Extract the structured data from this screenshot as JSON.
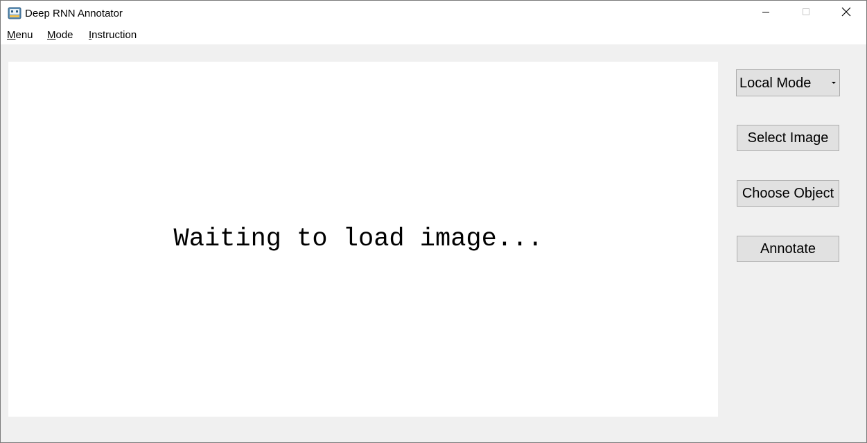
{
  "window": {
    "title": "Deep RNN Annotator"
  },
  "menubar": {
    "items": [
      {
        "accel": "M",
        "rest": "enu"
      },
      {
        "accel": "M",
        "rest": "ode"
      },
      {
        "accel": "I",
        "rest": "nstruction"
      }
    ]
  },
  "canvas": {
    "placeholder": "Waiting to load image..."
  },
  "controls": {
    "mode_select": "Local Mode",
    "select_image": "Select Image",
    "choose_object": "Choose Object",
    "annotate": "Annotate"
  },
  "icons": {
    "app": "robot-icon",
    "minimize": "minimize-icon",
    "maximize": "maximize-icon",
    "close": "close-icon",
    "dropdown": "dropdown-arrow-icon"
  }
}
